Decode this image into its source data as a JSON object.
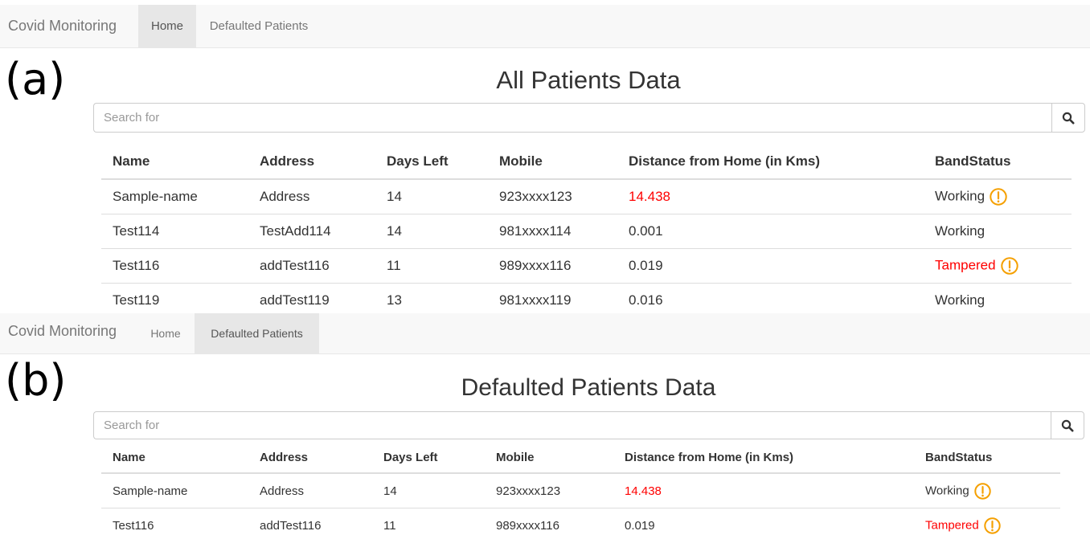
{
  "colors": {
    "alert": "#ff0000",
    "warning": "#f5a000",
    "navbar_bg": "#f8f8f8",
    "nav_active_bg": "#e7e7e7"
  },
  "panel_a": {
    "label": "(a)",
    "navbar": {
      "brand": "Covid Monitoring",
      "items": [
        {
          "label": "Home",
          "active": true
        },
        {
          "label": "Defaulted Patients",
          "active": false
        }
      ]
    },
    "title": "All Patients Data",
    "search": {
      "placeholder": "Search for",
      "icon": "search-icon"
    },
    "table": {
      "headers": [
        "Name",
        "Address",
        "Days Left",
        "Mobile",
        "Distance from Home (in Kms)",
        "BandStatus"
      ],
      "rows": [
        {
          "name": "Sample-name",
          "address": "Address",
          "days_left": "14",
          "mobile": "923xxxx123",
          "distance": "14.438",
          "distance_alert": true,
          "band_status": "Working",
          "band_alert": false,
          "warning_icon": true
        },
        {
          "name": "Test114",
          "address": "TestAdd114",
          "days_left": "14",
          "mobile": "981xxxx114",
          "distance": "0.001",
          "distance_alert": false,
          "band_status": "Working",
          "band_alert": false,
          "warning_icon": false
        },
        {
          "name": "Test116",
          "address": "addTest116",
          "days_left": "11",
          "mobile": "989xxxx116",
          "distance": "0.019",
          "distance_alert": false,
          "band_status": "Tampered",
          "band_alert": true,
          "warning_icon": true
        },
        {
          "name": "Test119",
          "address": "addTest119",
          "days_left": "13",
          "mobile": "981xxxx119",
          "distance": "0.016",
          "distance_alert": false,
          "band_status": "Working",
          "band_alert": false,
          "warning_icon": false
        }
      ]
    }
  },
  "panel_b": {
    "label": "(b)",
    "navbar": {
      "brand": "Covid Monitoring",
      "items": [
        {
          "label": "Home",
          "active": false
        },
        {
          "label": "Defaulted Patients",
          "active": true
        }
      ]
    },
    "title": "Defaulted Patients Data",
    "search": {
      "placeholder": "Search for",
      "icon": "search-icon"
    },
    "table": {
      "headers": [
        "Name",
        "Address",
        "Days Left",
        "Mobile",
        "Distance from Home (in Kms)",
        "BandStatus"
      ],
      "rows": [
        {
          "name": "Sample-name",
          "address": "Address",
          "days_left": "14",
          "mobile": "923xxxx123",
          "distance": "14.438",
          "distance_alert": true,
          "band_status": "Working",
          "band_alert": false,
          "warning_icon": true
        },
        {
          "name": "Test116",
          "address": "addTest116",
          "days_left": "11",
          "mobile": "989xxxx116",
          "distance": "0.019",
          "distance_alert": false,
          "band_status": "Tampered",
          "band_alert": true,
          "warning_icon": true
        }
      ]
    }
  }
}
